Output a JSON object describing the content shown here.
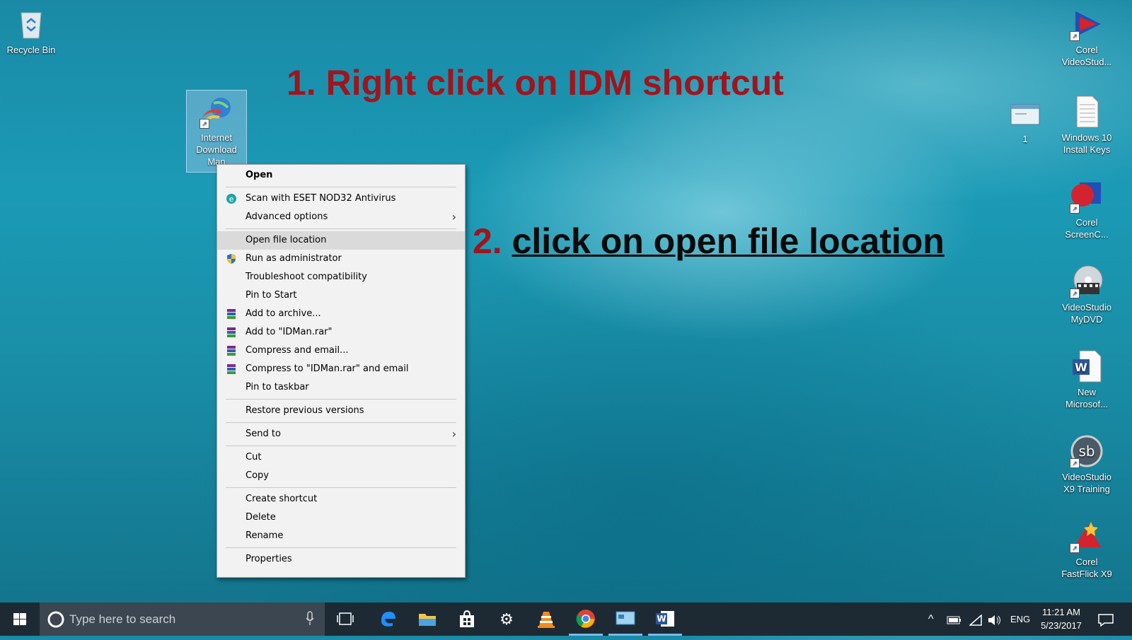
{
  "desktop_icons": {
    "recycle_bin": "Recycle Bin",
    "idm": "Internet Download Man",
    "corel_videostudio": "Corel VideoStud...",
    "file_1": "1",
    "win10_keys": "Windows 10 Install Keys",
    "corel_screencap": "Corel ScreenC...",
    "videostudio_mydvd": "VideoStudio MyDVD",
    "new_word": "New Microsof...",
    "videostudio_training": "VideoStudio X9 Training",
    "corel_fastflick": "Corel FastFlick X9"
  },
  "annotations": {
    "step1": "1. Right click on IDM shortcut",
    "step2_num": "2.",
    "step2_text": "click on open file location"
  },
  "context_menu": {
    "open": "Open",
    "scan": "Scan with ESET NOD32 Antivirus",
    "advanced": "Advanced options",
    "open_location": "Open file location",
    "run_admin": "Run as administrator",
    "troubleshoot": "Troubleshoot compatibility",
    "pin_start": "Pin to Start",
    "add_archive": "Add to archive...",
    "add_rar": "Add to \"IDMan.rar\"",
    "compress_email": "Compress and email...",
    "compress_rar_email": "Compress to \"IDMan.rar\" and email",
    "pin_taskbar": "Pin to taskbar",
    "restore": "Restore previous versions",
    "send_to": "Send to",
    "cut": "Cut",
    "copy": "Copy",
    "create_shortcut": "Create shortcut",
    "delete": "Delete",
    "rename": "Rename",
    "properties": "Properties",
    "highlighted_item": "Open file location"
  },
  "taskbar": {
    "search_placeholder": "Type here to search",
    "language": "ENG",
    "time": "11:21 AM",
    "date": "5/23/2017"
  },
  "colors": {
    "annotation_red": "#a0141e",
    "taskbar_bg": "#1d2a33",
    "menu_highlight": "#dadada"
  }
}
